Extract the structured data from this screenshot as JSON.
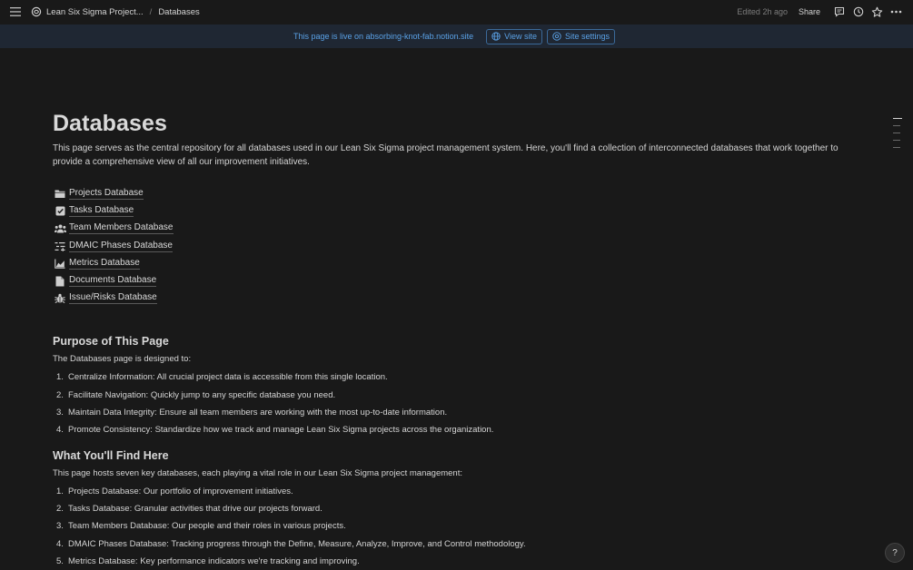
{
  "topbar": {
    "breadcrumbs": [
      "Lean Six Sigma Project...",
      "Databases"
    ],
    "separator": "/",
    "edited": "Edited 2h ago",
    "share_label": "Share"
  },
  "banner": {
    "live_text": "This page is live on absorbing-knot-fab.notion.site",
    "view_site_label": "View site",
    "site_settings_label": "Site settings"
  },
  "page": {
    "title": "Databases",
    "intro": "This page serves as the central repository for all databases used in our Lean Six Sigma project management system. Here, you'll find a collection of interconnected databases that work together to provide a comprehensive view of all our improvement initiatives.",
    "databases": [
      {
        "label": "Projects Database",
        "icon": "folder-icon"
      },
      {
        "label": "Tasks Database",
        "icon": "checkbox-icon"
      },
      {
        "label": "Team Members Database",
        "icon": "people-icon"
      },
      {
        "label": "DMAIC Phases Database",
        "icon": "phases-icon"
      },
      {
        "label": "Metrics Database",
        "icon": "chart-icon"
      },
      {
        "label": "Documents Database",
        "icon": "document-icon"
      },
      {
        "label": "Issue/Risks Database",
        "icon": "bug-icon"
      }
    ],
    "purpose": {
      "heading": "Purpose of This Page",
      "intro": "The Databases page is designed to:",
      "items": [
        {
          "num": "1.",
          "text": "Centralize Information: All crucial project data is accessible from this single location."
        },
        {
          "num": "2.",
          "text": "Facilitate Navigation: Quickly jump to any specific database you need."
        },
        {
          "num": "3.",
          "text": "Maintain Data Integrity: Ensure all team members are working with the most up-to-date information."
        },
        {
          "num": "4.",
          "text": "Promote Consistency: Standardize how we track and manage Lean Six Sigma projects across the organization."
        }
      ]
    },
    "find": {
      "heading": "What You'll Find Here",
      "intro": "This page hosts seven key databases, each playing a vital role in our Lean Six Sigma project management:",
      "items": [
        {
          "num": "1.",
          "text": "Projects Database: Our portfolio of improvement initiatives."
        },
        {
          "num": "2.",
          "text": "Tasks Database: Granular activities that drive our projects forward."
        },
        {
          "num": "3.",
          "text": "Team Members Database: Our people and their roles in various projects."
        },
        {
          "num": "4.",
          "text": "DMAIC Phases Database: Tracking progress through the Define, Measure, Analyze, Improve, and Control methodology."
        },
        {
          "num": "5.",
          "text": "Metrics Database: Key performance indicators we're tracking and improving."
        }
      ]
    }
  },
  "help_label": "?"
}
